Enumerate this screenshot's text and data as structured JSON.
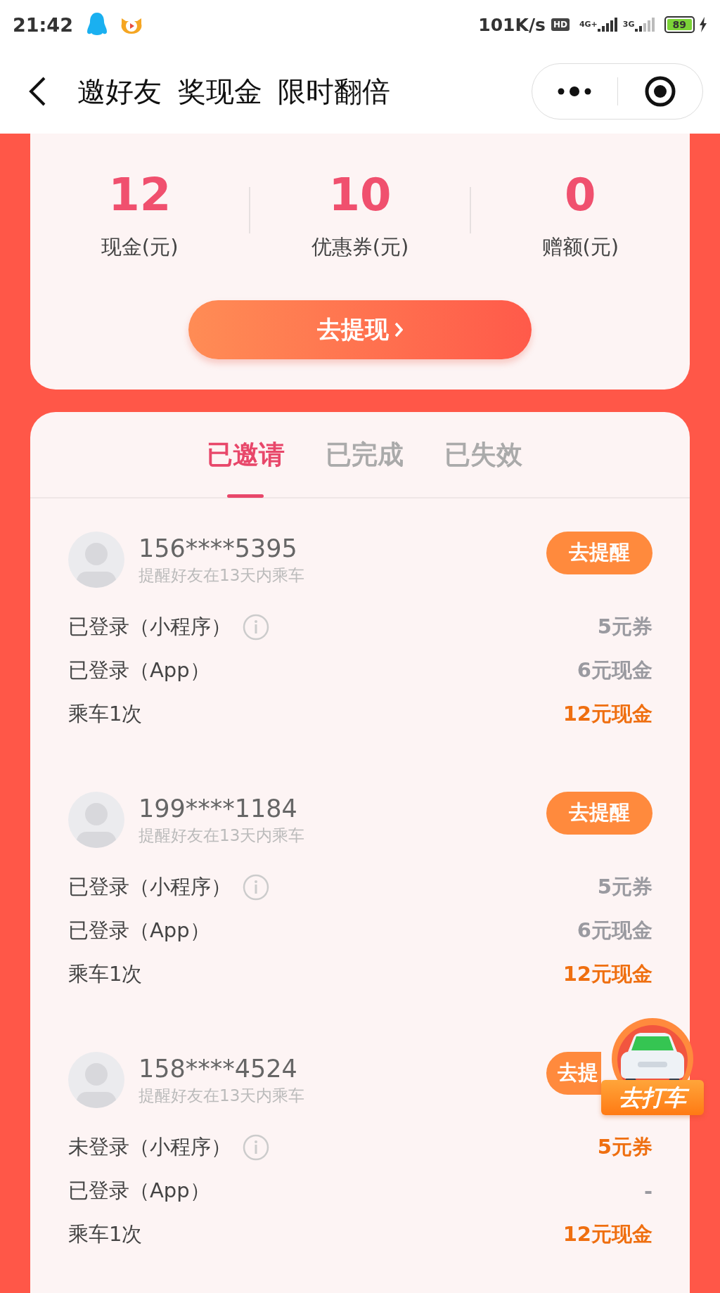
{
  "status_bar": {
    "time": "21:42",
    "speed": "101K/s",
    "hd": "HD",
    "network_1": "4G+",
    "network_2": "3G",
    "battery": "89"
  },
  "nav": {
    "title": "邀好友 奖现金 限时翻倍"
  },
  "stats": [
    {
      "value": "12",
      "label": "现金(元)"
    },
    {
      "value": "10",
      "label": "优惠券(元)"
    },
    {
      "value": "0",
      "label": "赠额(元)"
    }
  ],
  "withdraw_button": "去提现",
  "tabs": [
    {
      "label": "已邀请",
      "selected": true
    },
    {
      "label": "已完成",
      "selected": false
    },
    {
      "label": "已失效",
      "selected": false
    }
  ],
  "invites": [
    {
      "phone": "156****5395",
      "hint": "提醒好友在13天内乘车",
      "remind_button": "去提醒",
      "rows": [
        {
          "label": "已登录（小程序）",
          "info": true,
          "value": "5元券",
          "highlight": false
        },
        {
          "label": "已登录（App）",
          "info": false,
          "value": "6元现金",
          "highlight": false
        },
        {
          "label": "乘车1次",
          "info": false,
          "value": "12元现金",
          "highlight": true
        }
      ]
    },
    {
      "phone": "199****1184",
      "hint": "提醒好友在13天内乘车",
      "remind_button": "去提醒",
      "rows": [
        {
          "label": "已登录（小程序）",
          "info": true,
          "value": "5元券",
          "highlight": false
        },
        {
          "label": "已登录（App）",
          "info": false,
          "value": "6元现金",
          "highlight": false
        },
        {
          "label": "乘车1次",
          "info": false,
          "value": "12元现金",
          "highlight": true
        }
      ]
    },
    {
      "phone": "158****4524",
      "hint": "提醒好友在13天内乘车",
      "remind_button": "去提",
      "rows": [
        {
          "label": "未登录（小程序）",
          "info": true,
          "value": "5元券",
          "highlight": true
        },
        {
          "label": "已登录（App）",
          "info": false,
          "value": "-",
          "highlight": false
        },
        {
          "label": "乘车1次",
          "info": false,
          "value": "12元现金",
          "highlight": true
        }
      ]
    }
  ],
  "ride_button": "去打车"
}
